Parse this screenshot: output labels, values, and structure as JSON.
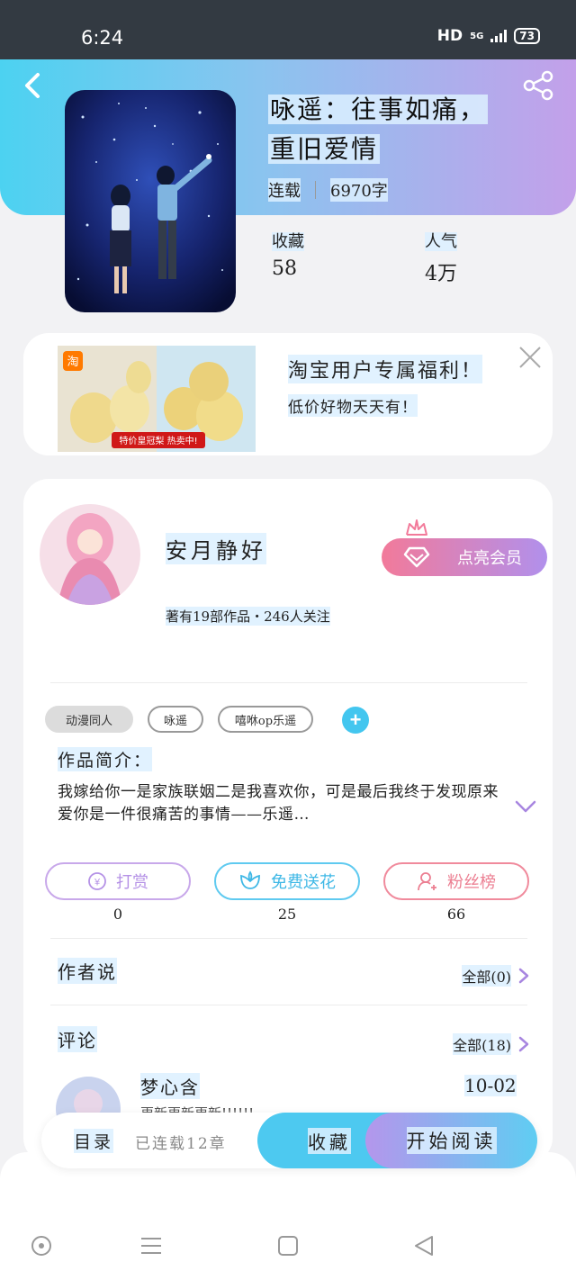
{
  "status_bar": {
    "time": "6:24",
    "network": "HD",
    "signal": "5G",
    "battery": "73"
  },
  "book": {
    "title_line1": "咏遥：往事如痛，",
    "title_line2": "重旧爱情",
    "status": "连载",
    "word_count": "6970字",
    "favorites_label": "收藏",
    "favorites_value": "58",
    "popularity_label": "人气",
    "popularity_value": "4万"
  },
  "ad": {
    "logo": "淘",
    "banner_text": "特价皇冠梨 热卖中!",
    "title": "淘宝用户专属福利！",
    "subtitle": "低价好物天天有！"
  },
  "author": {
    "name": "安月静好",
    "stats": "著有19部作品・246人关注",
    "vip_button": "点亮会员"
  },
  "tags": [
    "动漫同人",
    "咏遥",
    "嘻咻op乐遥"
  ],
  "intro": {
    "label": "作品简介：",
    "text": "我嫁给你一是家族联姻二是我喜欢你，可是最后我终于发现原来爱你是一件很痛苦的事情——乐遥…"
  },
  "actions": {
    "tip_label": "打赏",
    "tip_count": "0",
    "flower_label": "免费送花",
    "flower_count": "25",
    "fans_label": "粉丝榜",
    "fans_count": "66"
  },
  "author_says": {
    "title": "作者说",
    "link": "全部(0)"
  },
  "comments": {
    "title": "评论",
    "link": "全部(18)",
    "first": {
      "name": "梦心含",
      "date": "10-02",
      "text": "更新更新更新!!!!!!"
    }
  },
  "bottom_bar": {
    "catalog": "目录",
    "chapters": "已连载12章",
    "favorite": "收藏",
    "read": "开始阅读"
  },
  "colors": {
    "accent_blue": "#4dc9f0",
    "accent_purple": "#b496ec",
    "vip_pink": "#f27a9a"
  }
}
